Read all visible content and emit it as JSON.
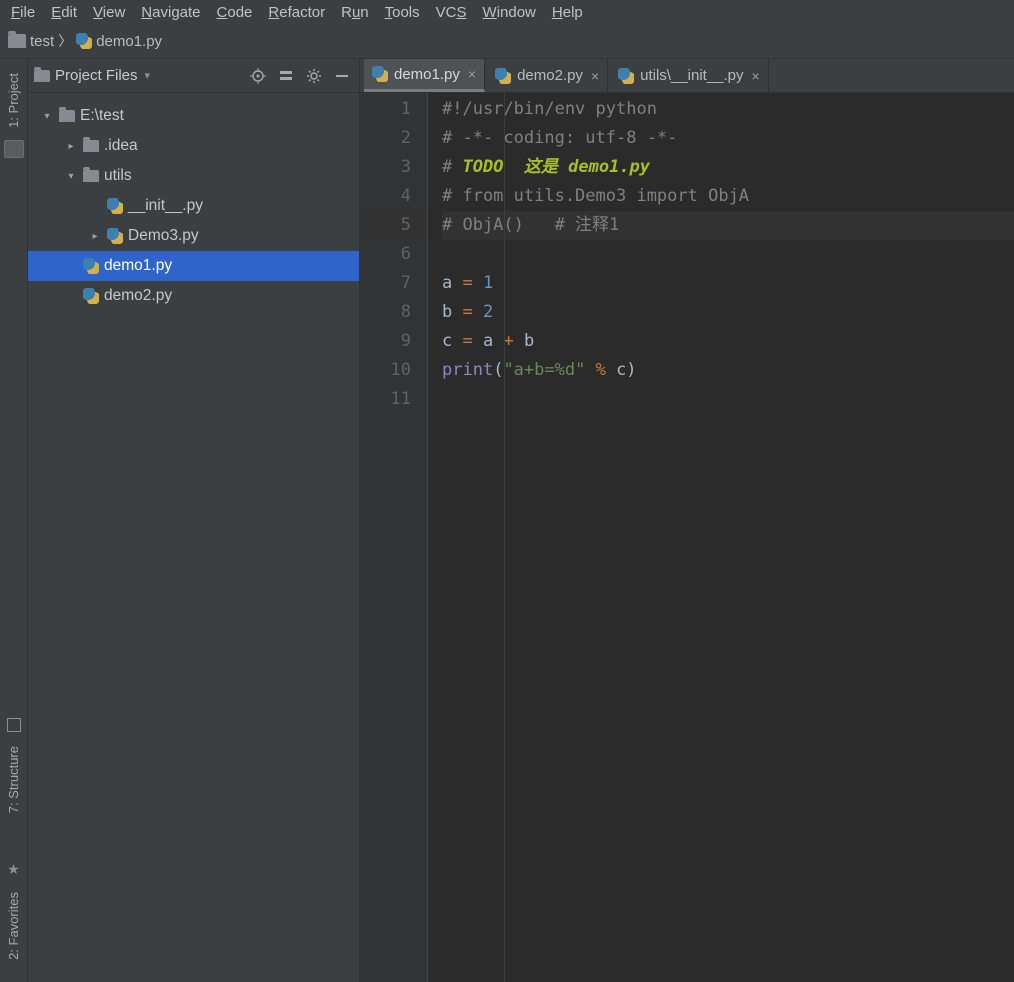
{
  "menu": {
    "items": [
      "File",
      "Edit",
      "View",
      "Navigate",
      "Code",
      "Refactor",
      "Run",
      "Tools",
      "VCS",
      "Window",
      "Help"
    ],
    "underlines": [
      "F",
      "E",
      "V",
      "N",
      "C",
      "R",
      "u",
      "T",
      "S",
      "W",
      "H"
    ]
  },
  "breadcrumb": {
    "crumbs": [
      {
        "type": "folder",
        "label": "test"
      },
      {
        "type": "py",
        "label": "demo1.py"
      }
    ]
  },
  "sidebar_header": {
    "title": "Project Files"
  },
  "left_toolstrip": {
    "project": "1: Project",
    "structure": "7: Structure",
    "favorites": "2: Favorites"
  },
  "tree": [
    {
      "depth": 0,
      "caret": "down",
      "icon": "folder",
      "name": "E:\\test",
      "selected": false
    },
    {
      "depth": 1,
      "caret": "right",
      "icon": "folder",
      "name": ".idea",
      "selected": false
    },
    {
      "depth": 1,
      "caret": "down",
      "icon": "folder",
      "name": "utils",
      "selected": false
    },
    {
      "depth": 2,
      "caret": "",
      "icon": "py",
      "name": "__init__.py",
      "selected": false
    },
    {
      "depth": 2,
      "caret": "right",
      "icon": "py",
      "name": "Demo3.py",
      "selected": false
    },
    {
      "depth": 1,
      "caret": "",
      "icon": "py",
      "name": "demo1.py",
      "selected": true
    },
    {
      "depth": 1,
      "caret": "",
      "icon": "py",
      "name": "demo2.py",
      "selected": false
    }
  ],
  "tabs": [
    {
      "label": "demo1.py",
      "active": true
    },
    {
      "label": "demo2.py",
      "active": false
    },
    {
      "label": "utils\\__init__.py",
      "active": false
    }
  ],
  "code": {
    "lines": [
      {
        "n": 1,
        "hl": false,
        "type": "comment",
        "text": "#!/usr/bin/env python"
      },
      {
        "n": 2,
        "hl": false,
        "type": "comment",
        "text": "# -*- coding: utf-8 -*-"
      },
      {
        "n": 3,
        "hl": false,
        "type": "todo",
        "prefix": "# ",
        "kw": "TODO",
        "rest": "  这是 demo1.py"
      },
      {
        "n": 4,
        "hl": false,
        "type": "comment",
        "text": "# from utils.Demo3 import ObjA"
      },
      {
        "n": 5,
        "hl": true,
        "type": "comment",
        "text": "# ObjA()   # 注释1"
      },
      {
        "n": 6,
        "hl": false,
        "type": "blank",
        "text": ""
      },
      {
        "n": 7,
        "hl": false,
        "type": "assign",
        "lhs": "a",
        "rhs_num": "1"
      },
      {
        "n": 8,
        "hl": false,
        "type": "assign",
        "lhs": "b",
        "rhs_num": "2"
      },
      {
        "n": 9,
        "hl": false,
        "type": "expr",
        "lhs": "c",
        "a": "a",
        "op": "+",
        "b": "b"
      },
      {
        "n": 10,
        "hl": false,
        "type": "print",
        "fn": "print",
        "str": "\"a+b=%d\"",
        "perc": "%",
        "arg": "c"
      },
      {
        "n": 11,
        "hl": false,
        "type": "blank",
        "text": ""
      }
    ]
  }
}
